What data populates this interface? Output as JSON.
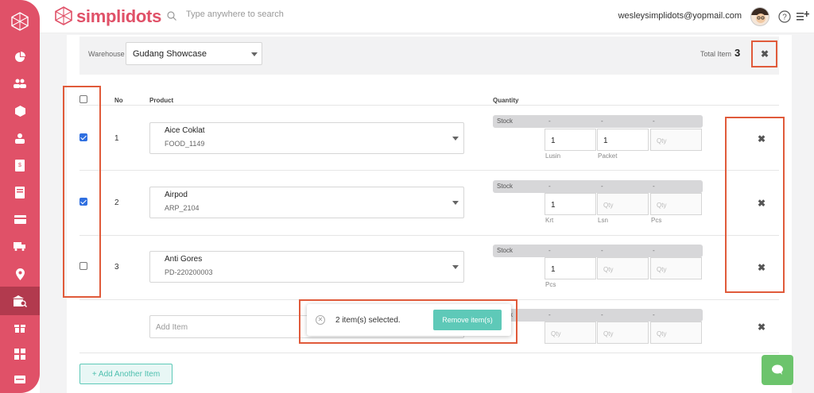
{
  "header": {
    "logo_text": "simplidots",
    "search_placeholder": "Type anywhere to search",
    "user_email": "wesleysimplidots@yopmail.com"
  },
  "sidebar": {
    "icons": [
      "network-logo-icon",
      "pie-chart-icon",
      "users-icon",
      "box-icon",
      "user-icon",
      "invoice-icon",
      "book-icon",
      "card-icon",
      "truck-icon",
      "location-icon",
      "warehouse-search-icon",
      "gift-icon",
      "grid-icon",
      "ticket-icon"
    ],
    "active": "warehouse-search-icon"
  },
  "warehouse": {
    "label": "Warehouse",
    "value": "Gudang Showcase",
    "total_label": "Total Item",
    "total_value": "3"
  },
  "table": {
    "headers": {
      "no": "No",
      "product": "Product",
      "quantity": "Quantity"
    },
    "stock_label": "Stock",
    "rows": [
      {
        "no": "1",
        "name": "Aice Coklat",
        "code": "FOOD_1149",
        "checked": true,
        "stock": [
          "-",
          "-",
          "-"
        ],
        "qty": [
          {
            "value": "1",
            "unit": "Lusin"
          },
          {
            "value": "1",
            "unit": "Packet"
          },
          {
            "placeholder": "Qty",
            "unit": ""
          }
        ]
      },
      {
        "no": "2",
        "name": "Airpod",
        "code": "ARP_2104",
        "checked": true,
        "stock": [
          "-",
          "-",
          "-"
        ],
        "qty": [
          {
            "value": "1",
            "unit": "Krt"
          },
          {
            "placeholder": "Qty",
            "unit": "Lsn"
          },
          {
            "placeholder": "Qty",
            "unit": "Pcs"
          }
        ]
      },
      {
        "no": "3",
        "name": "Anti Gores",
        "code": "PD-220200003",
        "checked": false,
        "stock": [
          "-",
          "-",
          "-"
        ],
        "qty": [
          {
            "value": "1",
            "unit": "Pcs"
          },
          {
            "placeholder": "Qty",
            "unit": ""
          },
          {
            "placeholder": "Qty",
            "unit": ""
          }
        ]
      }
    ],
    "add_row": {
      "placeholder": "Add Item",
      "stock": [
        "-",
        "-",
        "-"
      ],
      "qty_placeholder": "Qty"
    }
  },
  "add_another_label": "+ Add Another Item",
  "toast": {
    "text": "2 item(s) selected.",
    "button": "Remove item(s)"
  },
  "colors": {
    "brand": "#e05168",
    "accent": "#5ec9b8",
    "highlight": "#e05a3a"
  }
}
